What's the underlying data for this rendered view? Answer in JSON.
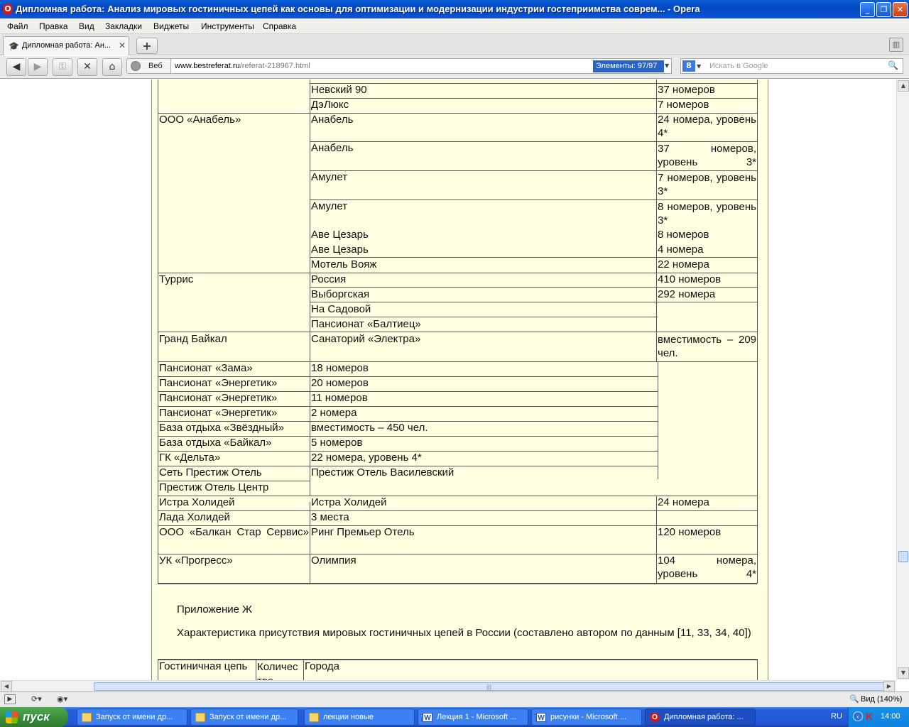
{
  "window": {
    "title": "Дипломная работа: Анализ мировых гостиничных цепей как основы для оптимизации и модернизации индустрии гостеприимства соврем... - Opera",
    "controls": {
      "minimize": "_",
      "maximize": "❐",
      "close": "✕"
    }
  },
  "menu": [
    "Файл",
    "Правка",
    "Вид",
    "Закладки",
    "Виджеты",
    "Инструменты",
    "Справка"
  ],
  "tab": {
    "title": "Дипломная работа: Ан...",
    "close": "✕"
  },
  "newtab": "+",
  "toolbar": {
    "web_label": "Веб",
    "url_host": "www.bestreferat.ru",
    "url_path": "/referat-218967.html",
    "elements_badge": "Элементы:   97/97",
    "search_placeholder": "Искать в Google",
    "search_engine_icon": "8"
  },
  "table_rows": [
    {
      "hotel": "Невский 90",
      "rooms": "37 номеров"
    },
    {
      "hotel": "ДэЛюкс",
      "rooms": "7 номеров"
    },
    {
      "owner": "ООО «Анабель»",
      "hotel": "Анабель",
      "rooms": "24 номера, уровень 4*"
    },
    {
      "hotel": "Анабель",
      "rooms": "37 номеров, уровень 3*"
    },
    {
      "hotel": "Амулет",
      "rooms": "7 номеров, уровень 3*"
    },
    {
      "hotel": "Амулет",
      "rooms": "8 номеров, уровень 3*"
    },
    {
      "hotel": "Аве Цезарь",
      "rooms": "8 номеров"
    },
    {
      "hotel": "Аве Цезарь",
      "rooms": "4 номера"
    },
    {
      "hotel": "Мотель Вояж",
      "rooms": "22 номера"
    },
    {
      "owner": "Туррис",
      "hotel": "Россия",
      "rooms": "410 номеров"
    },
    {
      "hotel": "Выборгская",
      "rooms": "292 номера"
    },
    {
      "hotel": "На Садовой",
      "rooms": ""
    },
    {
      "hotel": "Пансионат «Балтиец»",
      "rooms": ""
    },
    {
      "owner": "Гранд Байкал",
      "hotel": "Санаторий «Электра»",
      "rooms": "вместимость – 209 чел."
    },
    {
      "owner": "Пансионат «Зама»",
      "hotel": "18 номеров"
    },
    {
      "owner": "Пансионат «Энергетик»",
      "hotel": "20 номеров"
    },
    {
      "owner": "Пансионат «Энергетик»",
      "hotel": "11 номеров"
    },
    {
      "owner": "Пансионат «Энергетик»",
      "hotel": "2 номера"
    },
    {
      "owner": "База отдыха «Звёздный»",
      "hotel": "вместимость – 450 чел."
    },
    {
      "owner": "База отдыха «Байкал»",
      "hotel": "5 номеров"
    },
    {
      "owner": "ГК «Дельта»",
      "hotel": "22 номера, уровень 4*"
    },
    {
      "owner": "Сеть Престиж Отель",
      "hotel": "Престиж Отель Василевский"
    },
    {
      "owner": "Престиж Отель Центр"
    },
    {
      "owner": "Истра Холидей",
      "hotel": "Истра Холидей",
      "rooms": "24 номера"
    },
    {
      "owner": "Лада Холидей",
      "hotel": "3 места",
      "rooms": ""
    },
    {
      "owner": "ООО «Балкан Стар Сервис»",
      "hotel": "Ринг Премьер Отель",
      "rooms": "120 номеров"
    },
    {
      "owner": "УК «Прогресс»",
      "hotel": "Олимпия",
      "rooms": "104 номера, уровень 4*"
    }
  ],
  "appendix_title": "Приложение Ж",
  "appendix_caption": "Характеристика присутствия мировых гостиничных цепей в России (составлено автором по данным [11, 33, 34, 40])",
  "table2_headers": {
    "chain": "Гостиничная цепь",
    "count": "Количество",
    "cities": "Города"
  },
  "status": {
    "zoom": "Вид (140%)"
  },
  "taskbar": {
    "start": "пуск",
    "tasks": [
      "Запуск от имени др...",
      "Запуск от имени др...",
      "лекции новые",
      "Лекция 1 - Microsoft ...",
      "рисунки - Microsoft ...",
      "Дипломная работа: ..."
    ],
    "lang": "RU",
    "clock": "14:00"
  },
  "colors": {
    "page_bg": "#ffffe2",
    "titlebar": "#0a5fd8",
    "elements_badge": "#2a63c8",
    "taskbar": "#245edb"
  }
}
